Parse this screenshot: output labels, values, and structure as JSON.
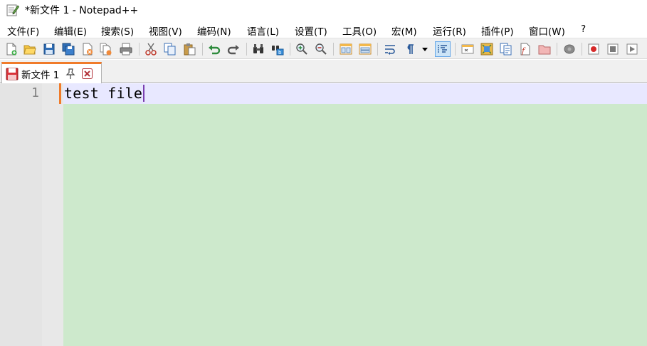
{
  "window": {
    "title": "*新文件 1 - Notepad++"
  },
  "menu": [
    {
      "label": "文件(F)"
    },
    {
      "label": "编辑(E)"
    },
    {
      "label": "搜索(S)"
    },
    {
      "label": "视图(V)"
    },
    {
      "label": "编码(N)"
    },
    {
      "label": "语言(L)"
    },
    {
      "label": "设置(T)"
    },
    {
      "label": "工具(O)"
    },
    {
      "label": "宏(M)"
    },
    {
      "label": "运行(R)"
    },
    {
      "label": "插件(P)"
    },
    {
      "label": "窗口(W)"
    },
    {
      "label": "?"
    }
  ],
  "toolbar": {
    "icons": [
      "new-file-icon",
      "open-file-icon",
      "save-icon",
      "save-all-icon",
      "close-icon",
      "close-all-icon",
      "print-icon",
      "cut-icon",
      "copy-icon",
      "paste-icon",
      "undo-icon",
      "redo-icon",
      "find-icon",
      "replace-icon",
      "zoom-in-icon",
      "zoom-out-icon",
      "sync-vertical-icon",
      "sync-horizontal-icon",
      "word-wrap-icon",
      "show-all-chars-icon",
      "dropdown-arrow-icon",
      "indent-guide-icon",
      "user-language-icon",
      "doc-map-icon",
      "doc-list-icon",
      "function-list-icon",
      "folder-workspace-icon",
      "monitoring-icon",
      "record-macro-icon",
      "stop-macro-icon",
      "play-macro-icon"
    ]
  },
  "tabs": [
    {
      "label": "新文件 1",
      "modified": true,
      "active": true
    }
  ],
  "editor": {
    "lines": [
      {
        "number": "1",
        "text": "test file"
      }
    ]
  },
  "colors": {
    "editor_background": "#cde9cc",
    "current_line": "#e8e8ff",
    "tab_accent": "#f07b2a",
    "gutter": "#e4e4e4"
  }
}
